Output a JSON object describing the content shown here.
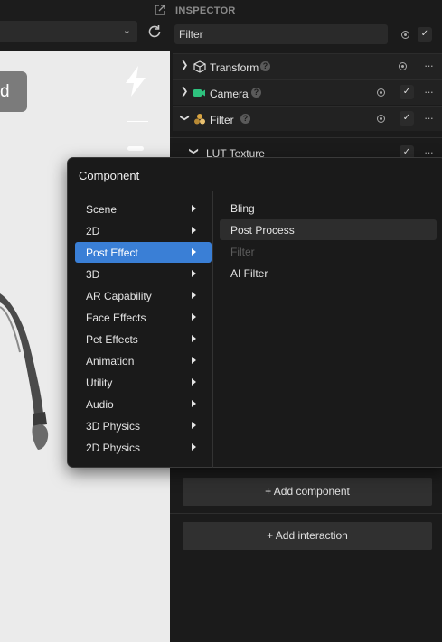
{
  "viewport": {
    "badge_text": "d"
  },
  "inspector": {
    "title": "INSPECTOR",
    "filter_value": "Filter",
    "components": [
      {
        "label": "Transform"
      },
      {
        "label": "Camera"
      },
      {
        "label": "Filter"
      }
    ],
    "lut_label": "LUT Texture",
    "add_component": "+ Add component",
    "add_interaction": "+ Add interaction"
  },
  "popup": {
    "title": "Component",
    "categories": [
      "Scene",
      "2D",
      "Post Effect",
      "3D",
      "AR Capability",
      "Face Effects",
      "Pet Effects",
      "Animation",
      "Utility",
      "Audio",
      "3D Physics",
      "2D Physics"
    ],
    "active_category": "Post Effect",
    "subitems": [
      "Bling",
      "Post Process",
      "Filter",
      "AI Filter"
    ],
    "hovered_subitem": "Post Process",
    "disabled_subitem": "Filter"
  },
  "colors": {
    "accent": "#3a7fd6",
    "camera_icon": "#2ec27e",
    "filter_icon": "#d9a441"
  }
}
